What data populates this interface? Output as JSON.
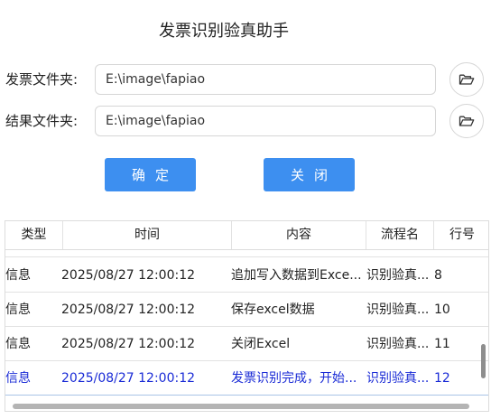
{
  "window": {
    "title": "发票识别验真助手"
  },
  "form": {
    "invoice_folder_label": "发票文件夹:",
    "invoice_folder_value": "E:\\image\\fapiao",
    "result_folder_label": "结果文件夹:",
    "result_folder_value": "E:\\image\\fapiao",
    "browse_icon": "folder-open-icon"
  },
  "buttons": {
    "confirm_label": "确定",
    "close_label": "关闭",
    "accent_color": "#3d8ff0"
  },
  "grid": {
    "columns": [
      "类型",
      "时间",
      "内容",
      "流程名",
      "行号"
    ],
    "rows": [
      {
        "type": "信息",
        "time": "2025/08/27 12:00:12",
        "content": "追加写入数据到Exce...",
        "flow": "识别验真...",
        "line": "8",
        "selected": false
      },
      {
        "type": "信息",
        "time": "2025/08/27 12:00:12",
        "content": "保存excel数据",
        "flow": "识别验真...",
        "line": "10",
        "selected": false
      },
      {
        "type": "信息",
        "time": "2025/08/27 12:00:12",
        "content": "关闭Excel",
        "flow": "识别验真...",
        "line": "11",
        "selected": false
      },
      {
        "type": "信息",
        "time": "2025/08/27 12:00:12",
        "content": "发票识别完成，开始...",
        "flow": "识别验真...",
        "line": "12",
        "selected": true
      }
    ],
    "selected_text_color": "#1a2bd6"
  }
}
